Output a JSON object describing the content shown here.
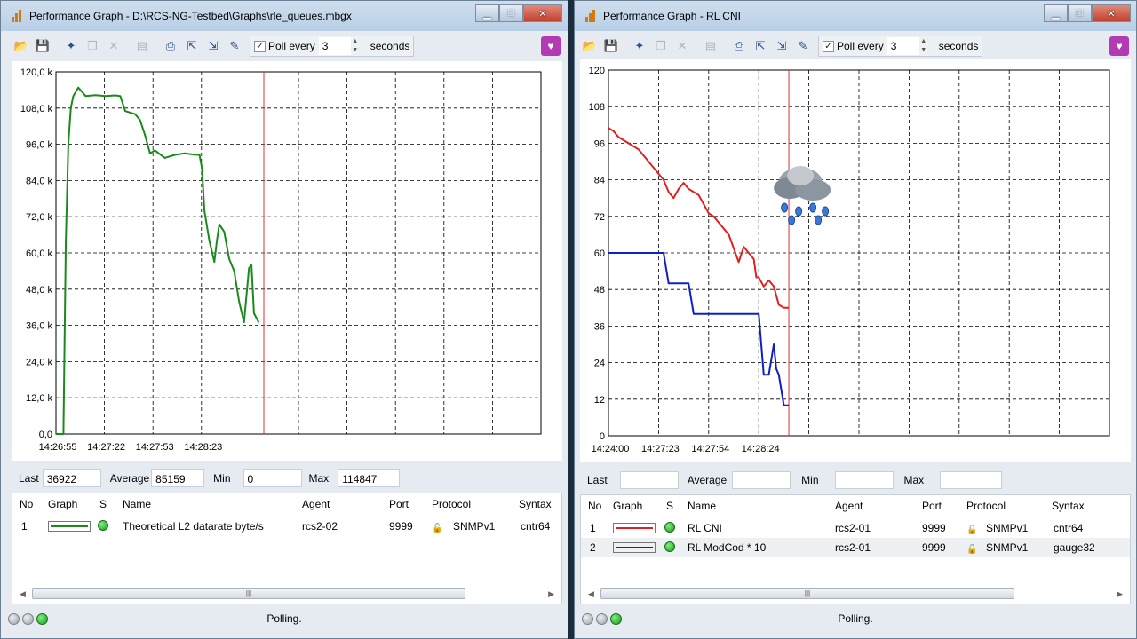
{
  "colors": {
    "title_bar": "#c4d6ea",
    "plot_bg": "#ffffff",
    "grid": "#000000",
    "marker": "#e03030",
    "series_green": "#1a8a1a",
    "series_red": "#e02020",
    "series_blue": "#1020c0"
  },
  "left": {
    "title": "Performance Graph - D:\\RCS-NG-Testbed\\Graphs\\rle_queues.mbgx",
    "poll": {
      "label": "Poll every",
      "value": "3",
      "unit": "seconds"
    },
    "stats": {
      "last_label": "Last",
      "last": "36922",
      "avg_label": "Average",
      "avg": "85159",
      "min_label": "Min",
      "min": "0",
      "max_label": "Max",
      "max": "114847"
    },
    "table": {
      "headers": [
        "No",
        "Graph",
        "S",
        "Name",
        "Agent",
        "Port",
        "Protocol",
        "Syntax"
      ],
      "rows": [
        {
          "no": "1",
          "color": "#1a8a1a",
          "name": "Theoretical L2 datarate byte/s",
          "agent": "rcs2-02",
          "port": "9999",
          "protocol": "SNMPv1",
          "syntax": "cntr64"
        }
      ]
    },
    "status": "Polling."
  },
  "right": {
    "title": "Performance Graph - RL CNI",
    "poll": {
      "label": "Poll every",
      "value": "3",
      "unit": "seconds"
    },
    "stats": {
      "last_label": "Last",
      "last": "",
      "avg_label": "Average",
      "avg": "",
      "min_label": "Min",
      "min": "",
      "max_label": "Max",
      "max": ""
    },
    "table": {
      "headers": [
        "No",
        "Graph",
        "S",
        "Name",
        "Agent",
        "Port",
        "Protocol",
        "Syntax"
      ],
      "rows": [
        {
          "no": "1",
          "color": "#e02020",
          "name": "RL CNI",
          "agent": "rcs2-01",
          "port": "9999",
          "protocol": "SNMPv1",
          "syntax": "cntr64"
        },
        {
          "no": "2",
          "color": "#1020c0",
          "name": "RL ModCod * 10",
          "agent": "rcs2-01",
          "port": "9999",
          "protocol": "SNMPv1",
          "syntax": "gauge32"
        }
      ]
    },
    "status": "Polling."
  },
  "chart_data": [
    {
      "type": "line",
      "grid": true,
      "ylim": [
        0,
        120000
      ],
      "yticks": [
        "0,0",
        "12,0 k",
        "24,0 k",
        "36,0 k",
        "48,0 k",
        "60,0 k",
        "72,0 k",
        "84,0 k",
        "96,0 k",
        "108,0 k",
        "120,0 k"
      ],
      "xticks": [
        "14:26:55",
        "14:27:22",
        "14:27:53",
        "14:28:23"
      ],
      "xlim_seconds": [
        0,
        98
      ],
      "marker_second": 42,
      "series": [
        {
          "name": "Theoretical L2 datarate byte/s",
          "color": "#1a8a1a",
          "x": [
            0,
            1.5,
            2,
            2.5,
            3,
            3.5,
            4.5,
            6,
            8,
            10,
            12,
            13,
            14,
            16,
            17,
            18,
            19,
            20,
            22,
            24,
            26,
            28,
            29,
            29.5,
            30,
            31,
            32,
            32.5,
            33,
            34,
            35,
            36,
            37,
            38,
            39,
            39.5,
            40,
            41
          ],
          "y": [
            0,
            0,
            64000,
            96000,
            108000,
            112000,
            114800,
            112000,
            112300,
            112000,
            112200,
            112000,
            107000,
            106000,
            104000,
            99000,
            93000,
            94000,
            91500,
            92500,
            93000,
            92600,
            92500,
            88000,
            74000,
            64000,
            57000,
            64000,
            69500,
            67000,
            58000,
            54000,
            44000,
            37000,
            55000,
            56000,
            40000,
            36900
          ]
        }
      ]
    },
    {
      "type": "line",
      "grid": true,
      "ylim": [
        0,
        120
      ],
      "yticks": [
        "0",
        "12",
        "24",
        "36",
        "48",
        "60",
        "72",
        "84",
        "96",
        "108",
        "120"
      ],
      "xticks": [
        "14:24:00",
        "14:27:23",
        "14:27:54",
        "14:28:24"
      ],
      "xlim_seconds": [
        0,
        100
      ],
      "marker_second": 36,
      "series": [
        {
          "name": "RL CNI",
          "color": "#e02020",
          "x": [
            0,
            1,
            2,
            4,
            6,
            8,
            10,
            11,
            12,
            13,
            14,
            15,
            16,
            17,
            18,
            19,
            20,
            21,
            22,
            24,
            26,
            27,
            28,
            29,
            29.5,
            30,
            31,
            32,
            32.5,
            33,
            34,
            35,
            35.5,
            36
          ],
          "y": [
            101,
            100,
            98,
            96,
            94,
            90,
            86,
            84,
            80,
            78,
            81,
            83,
            81,
            80,
            79,
            76,
            73,
            72,
            70,
            66,
            57,
            62,
            60,
            58,
            52,
            52,
            49,
            51,
            50,
            49,
            43,
            42,
            42,
            42
          ]
        },
        {
          "name": "RL ModCod * 10",
          "color": "#1020c0",
          "x": [
            0,
            11,
            12,
            16,
            17,
            30,
            31,
            32,
            33,
            33.5,
            34,
            35,
            36
          ],
          "y": [
            60,
            60,
            50,
            50,
            40,
            40,
            20,
            20,
            30,
            22,
            20,
            10,
            10
          ]
        }
      ]
    }
  ]
}
